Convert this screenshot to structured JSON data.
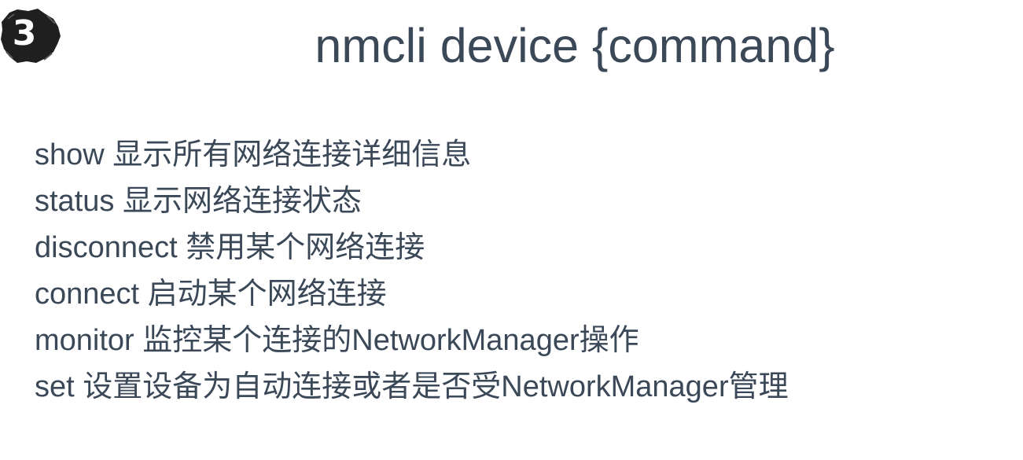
{
  "badge": {
    "number": "3"
  },
  "slide": {
    "title": "nmcli device {command}",
    "items": [
      "show 显示所有网络连接详细信息",
      "status 显示网络连接状态",
      "disconnect 禁用某个网络连接",
      "connect 启动某个网络连接",
      "monitor 监控某个连接的NetworkManager操作",
      "set 设置设备为自动连接或者是否受NetworkManager管理"
    ]
  },
  "colors": {
    "text": "#3b4858",
    "badge_fill": "#1f1f1f",
    "background": "#ffffff"
  }
}
